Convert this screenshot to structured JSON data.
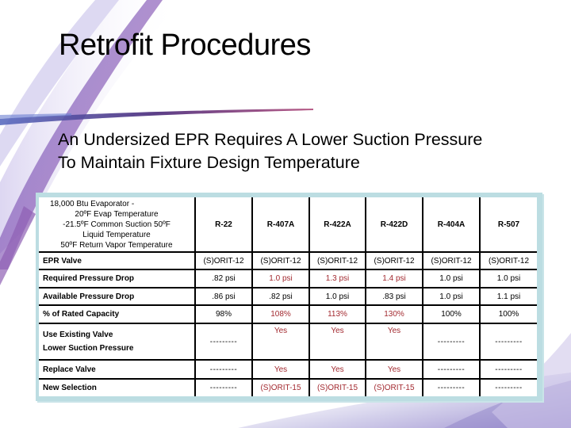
{
  "slide": {
    "title": "Retrofit Procedures",
    "subtitle_lines": [
      "An Undersized EPR Requires A Lower Suction Pressure",
      "To Maintain Fixture Design Temperature"
    ],
    "colors": {
      "frame": "#bcdde2",
      "grid": "#000000",
      "highlight_text": "#a32a30",
      "accent_purple": "#6b5bb5"
    }
  },
  "table": {
    "conditions": [
      "18,000 Btu Evaporator -",
      "20ºF Evap Temperature",
      "-21.5ºF Common Suction 50ºF",
      "Liquid Temperature",
      "50ºF Return Vapor Temperature"
    ],
    "refrigerants": [
      "R-22",
      "R-407A",
      "R-422A",
      "R-422D",
      "R-404A",
      "R-507"
    ],
    "rows": [
      {
        "label": "EPR Valve",
        "cells": [
          {
            "text": "(S)ORIT-12",
            "highlight": false
          },
          {
            "text": "(S)ORIT-12",
            "highlight": false
          },
          {
            "text": "(S)ORIT-12",
            "highlight": false
          },
          {
            "text": "(S)ORIT-12",
            "highlight": false
          },
          {
            "text": "(S)ORIT-12",
            "highlight": false
          },
          {
            "text": "(S)ORIT-12",
            "highlight": false
          }
        ]
      },
      {
        "label": "Required Pressure Drop",
        "cells": [
          {
            "text": ".82 psi",
            "highlight": false
          },
          {
            "text": "1.0 psi",
            "highlight": true
          },
          {
            "text": "1.3 psi",
            "highlight": true
          },
          {
            "text": "1.4 psi",
            "highlight": true
          },
          {
            "text": "1.0 psi",
            "highlight": false
          },
          {
            "text": "1.0 psi",
            "highlight": false
          }
        ]
      },
      {
        "label": "Available Pressure Drop",
        "cells": [
          {
            "text": ".86 psi",
            "highlight": false
          },
          {
            "text": ".82 psi",
            "highlight": false
          },
          {
            "text": "1.0 psi",
            "highlight": false
          },
          {
            "text": ".83 psi",
            "highlight": false
          },
          {
            "text": "1.0 psi",
            "highlight": false
          },
          {
            "text": "1.1 psi",
            "highlight": false
          }
        ]
      },
      {
        "label": "% of Rated Capacity",
        "cells": [
          {
            "text": "98%",
            "highlight": false
          },
          {
            "text": "108%",
            "highlight": true
          },
          {
            "text": "113%",
            "highlight": true
          },
          {
            "text": "130%",
            "highlight": true
          },
          {
            "text": "100%",
            "highlight": false
          },
          {
            "text": "100%",
            "highlight": false
          }
        ]
      },
      {
        "label_lines": [
          "Use Existing Valve",
          "Lower Suction Pressure"
        ],
        "cells": [
          {
            "text": "---------",
            "highlight": false
          },
          {
            "text": "Yes",
            "highlight": true
          },
          {
            "text": "Yes",
            "highlight": true
          },
          {
            "text": "Yes",
            "highlight": true
          },
          {
            "text": "---------",
            "highlight": false
          },
          {
            "text": "---------",
            "highlight": false
          }
        ]
      },
      {
        "label": "Replace Valve",
        "cells": [
          {
            "text": "---------",
            "highlight": false
          },
          {
            "text": "Yes",
            "highlight": true
          },
          {
            "text": "Yes",
            "highlight": true
          },
          {
            "text": "Yes",
            "highlight": true
          },
          {
            "text": "---------",
            "highlight": false
          },
          {
            "text": "---------",
            "highlight": false
          }
        ]
      },
      {
        "label": "New Selection",
        "cells": [
          {
            "text": "---------",
            "highlight": false
          },
          {
            "text": "(S)ORIT-15",
            "highlight": true
          },
          {
            "text": "(S)ORIT-15",
            "highlight": true
          },
          {
            "text": "(S)ORIT-15",
            "highlight": true
          },
          {
            "text": "---------",
            "highlight": false
          },
          {
            "text": "---------",
            "highlight": false
          }
        ]
      }
    ]
  }
}
